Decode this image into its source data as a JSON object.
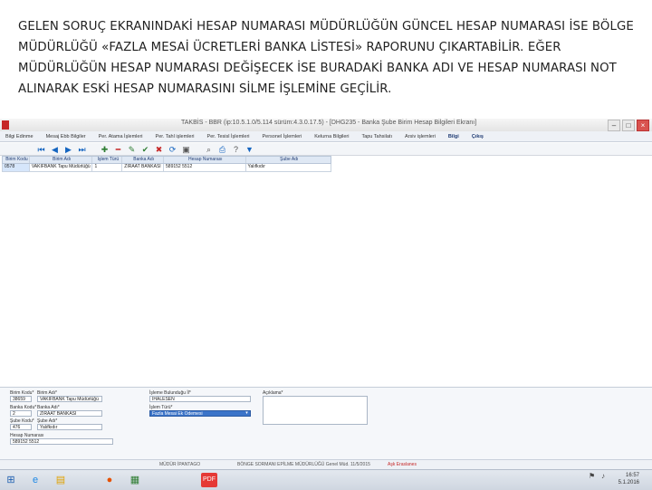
{
  "caption": "GELEN SORUÇ EKRANINDAKİ HESAP NUMARASI MÜDÜRLÜĞÜN GÜNCEL HESAP NUMARASI İSE BÖLGE MÜDÜRLÜĞÜ «FAZLA MESAİ ÜCRETLERİ BANKA LİSTESİ» RAPORUNU ÇIKARTABİLİR. EĞER MÜDÜRLÜĞÜN HESAP NUMARASI DEĞİŞECEK İSE BURADAKİ BANKA ADI VE HESAP NUMARASI NOT ALINARAK ESKİ HESAP NUMARASINI SİLME İŞLEMİNE GEÇİLİR.",
  "window": {
    "title": "TAKBİS - BBR (ip:10.5.1.0/5.114 sürüm:4.3.0.17.5) - [DHG235 - Banka Şube Birim Hesap Bilgileri Ekranı]"
  },
  "menu": [
    "Bilgi Edinme",
    "Mesaj Ebb Bilgiler",
    "Per. Atama İşlemleri",
    "Per. Tahl işlemleri",
    "Per. Tesisl İşlemleri",
    "Personel İşlemleri",
    "Kelurna Bilgileri",
    "Tapu Tahsilatı",
    "Arsiv işlemleri",
    "Bilgi",
    "Çıkış"
  ],
  "grid": {
    "headers": [
      "Birim Kodu",
      "Birim Adı",
      "İşlem Türü",
      "Banka Adı",
      "Hesap Numarası",
      "Şube Adı"
    ],
    "rows": [
      [
        "0578",
        "VAKIFBANK Tapu Müdürlüğü",
        "1",
        "ZİRAAT BANKASI",
        "589152 5512",
        "Yalıfkıdır"
      ]
    ]
  },
  "form": {
    "birim_kodu_label": "Birim Kodu*",
    "birim_kodu": "38659",
    "birim_adi_label": "Birim Adı*",
    "birim_adi": "VAKIFBANK Tapu Müdürlüğü",
    "banka_kodu_label": "Banka Kodu*",
    "banka_kodu": "2",
    "banka_adi_label": "Banka Adı*",
    "banka_adi": "ZİRAAT BANKASI",
    "sube_kodu_label": "Şube Kodu*",
    "sube_kodu": "476",
    "sube_adi_label": "Şube Adı*",
    "sube_adi": "Yalıfkıdır",
    "hesap_no_label": "Hesap Numarası",
    "hesap_no": "589152 5512",
    "sorumlu_label": "İşleme Bulunduğu İl*",
    "sorumlu": "İHALESEN",
    "islem_turu_label": "İşlem Türü*",
    "islem_turu": "Fazla Mesai Ek Ödemesi",
    "aciklama_label": "Açıklama*"
  },
  "statusbar": {
    "left": "MÜDÜR İPANTAGO",
    "mid": "BÖNGE SORMANI EPİLME MÜDÜRLÜĞÜ Genel Müd. 11/5/2015",
    "right": "Aşk Eraslanes"
  },
  "taskbar": {
    "time": "16:57",
    "date": "5.1.2016",
    "icons": [
      "start-icon",
      "ie-icon",
      "folder-icon",
      "firefox-icon",
      "app-icon",
      "pdf-icon"
    ]
  }
}
